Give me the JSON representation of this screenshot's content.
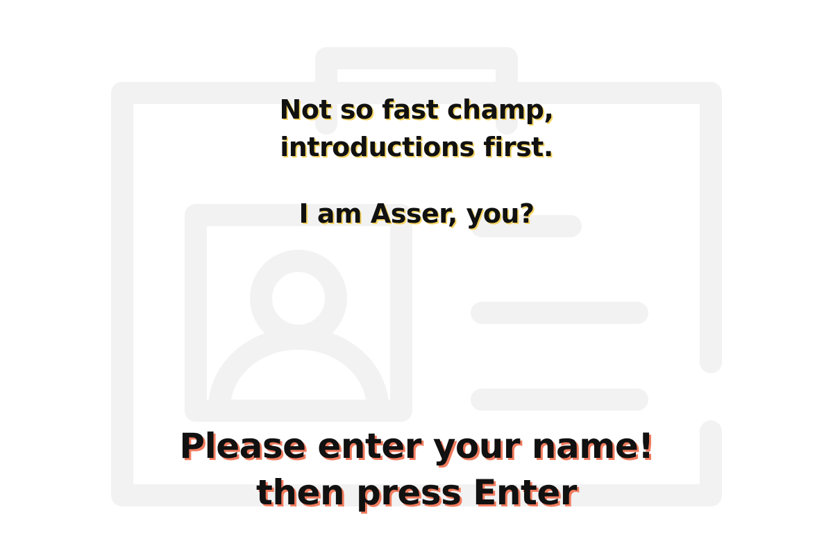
{
  "colors": {
    "background": "#ffffff",
    "card_outline": "#f2f2f2",
    "text": "#111111",
    "intro_shadow": "#f5d565",
    "prompt_shadow": "#f27c5f"
  },
  "background_icon": "id-card-icon",
  "intro": {
    "line1": "Not so fast champ,",
    "line2": "introductions first.",
    "line3": "I am Asser, you?"
  },
  "prompt": {
    "line1": "Please enter your name!",
    "line2": "then press Enter"
  }
}
